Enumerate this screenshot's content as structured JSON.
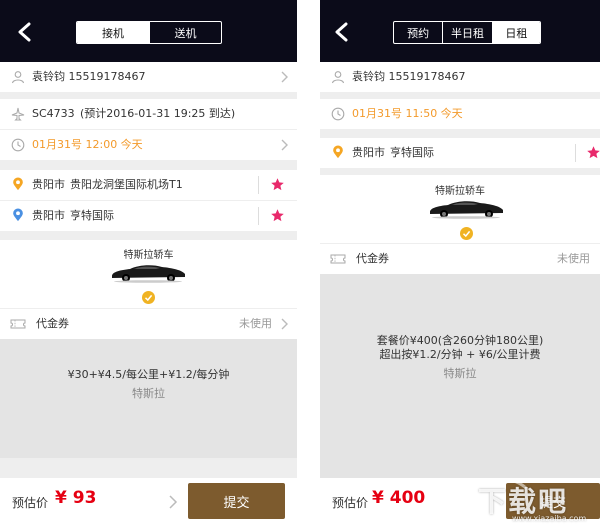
{
  "left": {
    "tabs": [
      "接机",
      "送机"
    ],
    "active_tab": 0,
    "contact": "袁铃钧  15519178467",
    "flight_no": "SC4733",
    "flight_eta": "(预计2016-01-31 19:25 到达)",
    "time": "01月31号 12:00 今天",
    "from_city": "贵阳市",
    "from_place": "贵阳龙洞堡国际机场T1",
    "to_city": "贵阳市",
    "to_place": "亨特国际",
    "car_name": "特斯拉轿车",
    "voucher_label": "代金券",
    "voucher_status": "未使用",
    "price_formula": "¥30+¥4.5/每公里+¥1.2/每分钟",
    "price_model": "特斯拉",
    "estimate_label": "预估价",
    "estimate_value": "¥ 93",
    "submit_label": "提交"
  },
  "right": {
    "tabs": [
      "预约",
      "半日租",
      "日租"
    ],
    "active_tab": 2,
    "contact": "袁铃钧  15519178467",
    "time": "01月31号 11:50 今天",
    "city": "贵阳市",
    "place": "亨特国际",
    "car_name": "特斯拉轿车",
    "voucher_label": "代金券",
    "voucher_status": "未使用",
    "package_line1": "套餐价¥400(含260分钟180公里)",
    "package_line2": "超出按¥1.2/分钟 + ¥6/公里计费",
    "price_model": "特斯拉",
    "estimate_label": "预估价",
    "estimate_value": "¥ 400",
    "submit_label": "提交"
  },
  "watermark": {
    "text": "下载吧",
    "url": "www.xiazaiba.com"
  },
  "colors": {
    "navbar": "#0b0b19",
    "accent_orange": "#f39a2b",
    "price_red": "#e60012",
    "submit_brown": "#7d5b2e",
    "star_pink": "#e8296b",
    "pin_orange": "#f5a623",
    "pin_blue": "#4a90e2",
    "check_gold": "#f0b323"
  },
  "icons": [
    "back-arrow-icon",
    "user-icon",
    "plane-icon",
    "clock-icon",
    "pin-orange-icon",
    "pin-blue-icon",
    "star-icon",
    "chevron-right-icon",
    "ticket-icon",
    "check-circle-icon",
    "car-icon"
  ]
}
